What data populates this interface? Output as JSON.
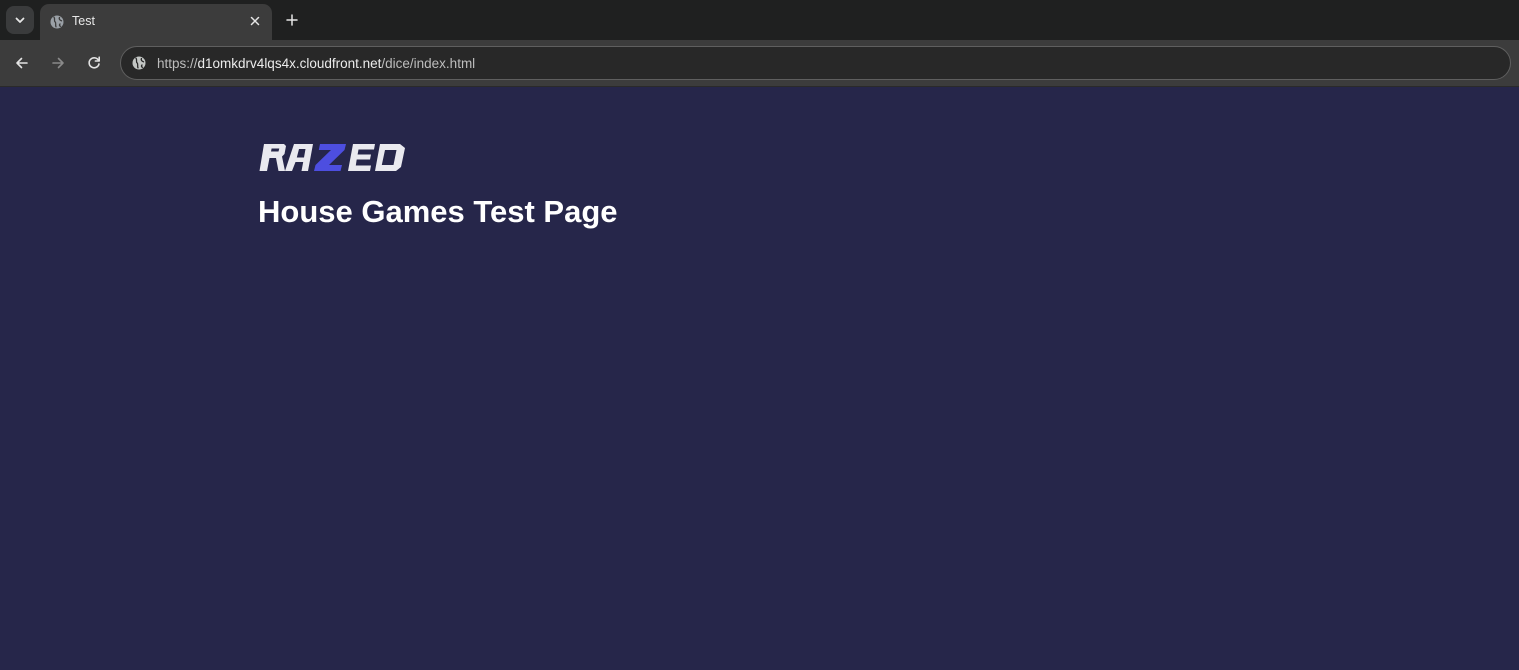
{
  "browser": {
    "tab": {
      "title": "Test",
      "favicon": "globe-icon"
    },
    "omnibox": {
      "scheme": "https://",
      "host": "d1omkdrv4lqs4x.cloudfront.net",
      "path": "/dice/index.html"
    },
    "icons": {
      "tab_search": "chevron-down-icon",
      "close": "close-icon",
      "new_tab": "plus-icon",
      "back": "arrow-left-icon",
      "forward": "arrow-right-icon",
      "reload": "reload-icon",
      "site_info": "globe-icon"
    }
  },
  "page": {
    "logo": {
      "text": "RAZED",
      "accent_letter": "Z",
      "letter_color": "#e9e9ef",
      "accent_color": "#4d4ee0"
    },
    "title": "House Games Test Page",
    "background": "#26264a"
  }
}
